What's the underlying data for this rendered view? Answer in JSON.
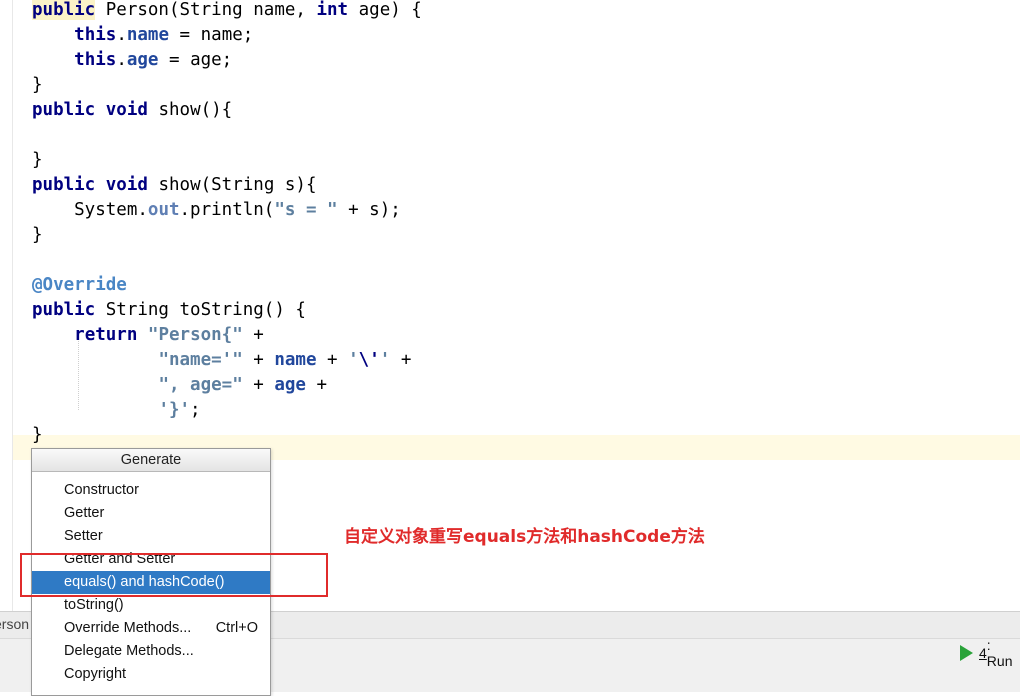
{
  "editor": {
    "lines": [
      {
        "id": "l0",
        "segments": [
          {
            "t": "public",
            "c": "kw warn-hl"
          },
          {
            "t": " Person(String name, "
          },
          {
            "t": "int",
            "c": "kw"
          },
          {
            "t": " age) {"
          }
        ]
      },
      {
        "id": "l1",
        "segments": [
          {
            "t": "    "
          },
          {
            "t": "this",
            "c": "kw"
          },
          {
            "t": "."
          },
          {
            "t": "name",
            "c": "fld"
          },
          {
            "t": " = name;"
          }
        ]
      },
      {
        "id": "l2",
        "segments": [
          {
            "t": "    "
          },
          {
            "t": "this",
            "c": "kw"
          },
          {
            "t": "."
          },
          {
            "t": "age",
            "c": "fld"
          },
          {
            "t": " = age;"
          }
        ]
      },
      {
        "id": "l3",
        "segments": [
          {
            "t": "}"
          }
        ]
      },
      {
        "id": "l4",
        "segments": [
          {
            "t": "public",
            "c": "kw"
          },
          {
            "t": " "
          },
          {
            "t": "void",
            "c": "kw"
          },
          {
            "t": " show(){"
          }
        ]
      },
      {
        "id": "l5",
        "segments": [
          {
            "t": ""
          }
        ]
      },
      {
        "id": "l6",
        "segments": [
          {
            "t": "}"
          }
        ]
      },
      {
        "id": "l7",
        "segments": [
          {
            "t": "public",
            "c": "kw"
          },
          {
            "t": " "
          },
          {
            "t": "void",
            "c": "kw"
          },
          {
            "t": " show(String s){"
          }
        ]
      },
      {
        "id": "l8",
        "segments": [
          {
            "t": "    System."
          },
          {
            "t": "out",
            "c": "st"
          },
          {
            "t": ".println("
          },
          {
            "t": "\"s = \"",
            "c": "str"
          },
          {
            "t": " + s);"
          }
        ]
      },
      {
        "id": "l9",
        "segments": [
          {
            "t": "}"
          }
        ]
      },
      {
        "id": "l10",
        "segments": [
          {
            "t": ""
          }
        ]
      },
      {
        "id": "l11",
        "segments": [
          {
            "t": "@Override",
            "c": "ann"
          }
        ]
      },
      {
        "id": "l12",
        "segments": [
          {
            "t": "public",
            "c": "kw"
          },
          {
            "t": " String toString() {"
          }
        ]
      },
      {
        "id": "l13",
        "segments": [
          {
            "t": "    "
          },
          {
            "t": "return",
            "c": "kw"
          },
          {
            "t": " "
          },
          {
            "t": "\"Person{\"",
            "c": "str"
          },
          {
            "t": " +"
          }
        ]
      },
      {
        "id": "l14",
        "segments": [
          {
            "t": "            "
          },
          {
            "t": "\"name='\"",
            "c": "str"
          },
          {
            "t": " + "
          },
          {
            "t": "name",
            "c": "fld"
          },
          {
            "t": " + "
          },
          {
            "t": "'",
            "c": "str"
          },
          {
            "t": "\\'",
            "c": "esc"
          },
          {
            "t": "'",
            "c": "str"
          },
          {
            "t": " +"
          }
        ]
      },
      {
        "id": "l15",
        "segments": [
          {
            "t": "            "
          },
          {
            "t": "\", age=\"",
            "c": "str"
          },
          {
            "t": " + "
          },
          {
            "t": "age",
            "c": "fld"
          },
          {
            "t": " +"
          }
        ]
      },
      {
        "id": "l16",
        "segments": [
          {
            "t": "            "
          },
          {
            "t": "'}'",
            "c": "str"
          },
          {
            "t": ";"
          }
        ]
      },
      {
        "id": "l17",
        "segments": [
          {
            "t": "}"
          }
        ]
      }
    ]
  },
  "status": {
    "breadcrumb": "erson"
  },
  "bottom_bar": {
    "run_tab": {
      "number": "4",
      "label": ": Run"
    }
  },
  "generate_popup": {
    "title": "Generate",
    "items": [
      {
        "label": "Constructor",
        "shortcut": "",
        "selected": false
      },
      {
        "label": "Getter",
        "shortcut": "",
        "selected": false
      },
      {
        "label": "Setter",
        "shortcut": "",
        "selected": false
      },
      {
        "label": "Getter and Setter",
        "shortcut": "",
        "selected": false
      },
      {
        "label": "equals() and hashCode()",
        "shortcut": "",
        "selected": true
      },
      {
        "label": "toString()",
        "shortcut": "",
        "selected": false
      },
      {
        "label": "Override Methods...",
        "shortcut": "Ctrl+O",
        "selected": false
      },
      {
        "label": "Delegate Methods...",
        "shortcut": "",
        "selected": false
      },
      {
        "label": "Copyright",
        "shortcut": "",
        "selected": false
      }
    ]
  },
  "annotation": {
    "text": "自定义对象重写equals方法和hashCode方法",
    "color": "#e02b2b"
  },
  "colors": {
    "selection": "#2f7ac5",
    "keyword": "#000080",
    "string": "#5d7f9f"
  }
}
